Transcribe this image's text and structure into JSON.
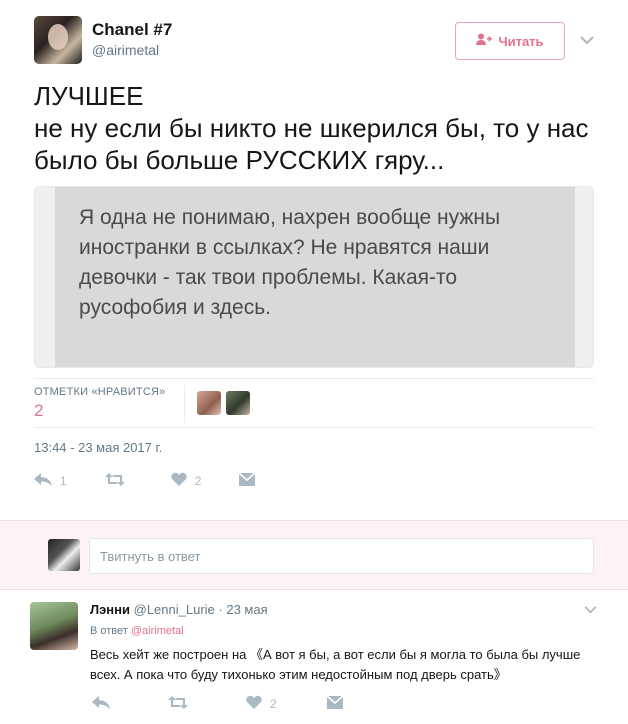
{
  "tweet": {
    "author_name": "Chanel #7",
    "author_handle": "@airimetal",
    "follow_label": "Читать",
    "text": "ЛУЧШЕЕ\nне ну если бы никто не шкерился  бы, то у нас было бы больше РУССКИХ гяру...",
    "quote_text": "Я одна не понимаю, нахрен вообще нужны иностранки в ссылках? Не нравятся наши девочки - так твои проблемы. Какая-то русофобия и здесь.",
    "likes_label": "ОТМЕТКИ «НРАВИТСЯ»",
    "likes_count": "2",
    "timestamp": "13:44 - 23 мая 2017 г.",
    "actions": {
      "reply_count": "1",
      "retweet_count": "",
      "like_count": "2"
    }
  },
  "reply_box": {
    "placeholder": "Твитнуть в ответ"
  },
  "reply": {
    "name": "Лэнни",
    "handle": "@Lenni_Lurie",
    "time": "· 23 мая",
    "in_reply_prefix": "В ответ",
    "in_reply_mention": "@airimetal",
    "text": "Весь хейт же построен на 《А вот я бы, а вот если бы я могла то была бы лучше всех. А пока что буду тихонько этим недостойным под дверь срать》",
    "actions": {
      "reply_count": "",
      "retweet_count": "",
      "like_count": "2"
    }
  },
  "colors": {
    "accent": "#e0738b",
    "muted": "#657786",
    "icon": "#aab8c2"
  },
  "icons": [
    "follow-user-icon",
    "chevron-down-icon",
    "reply-icon",
    "retweet-icon",
    "heart-icon",
    "dm-icon"
  ]
}
